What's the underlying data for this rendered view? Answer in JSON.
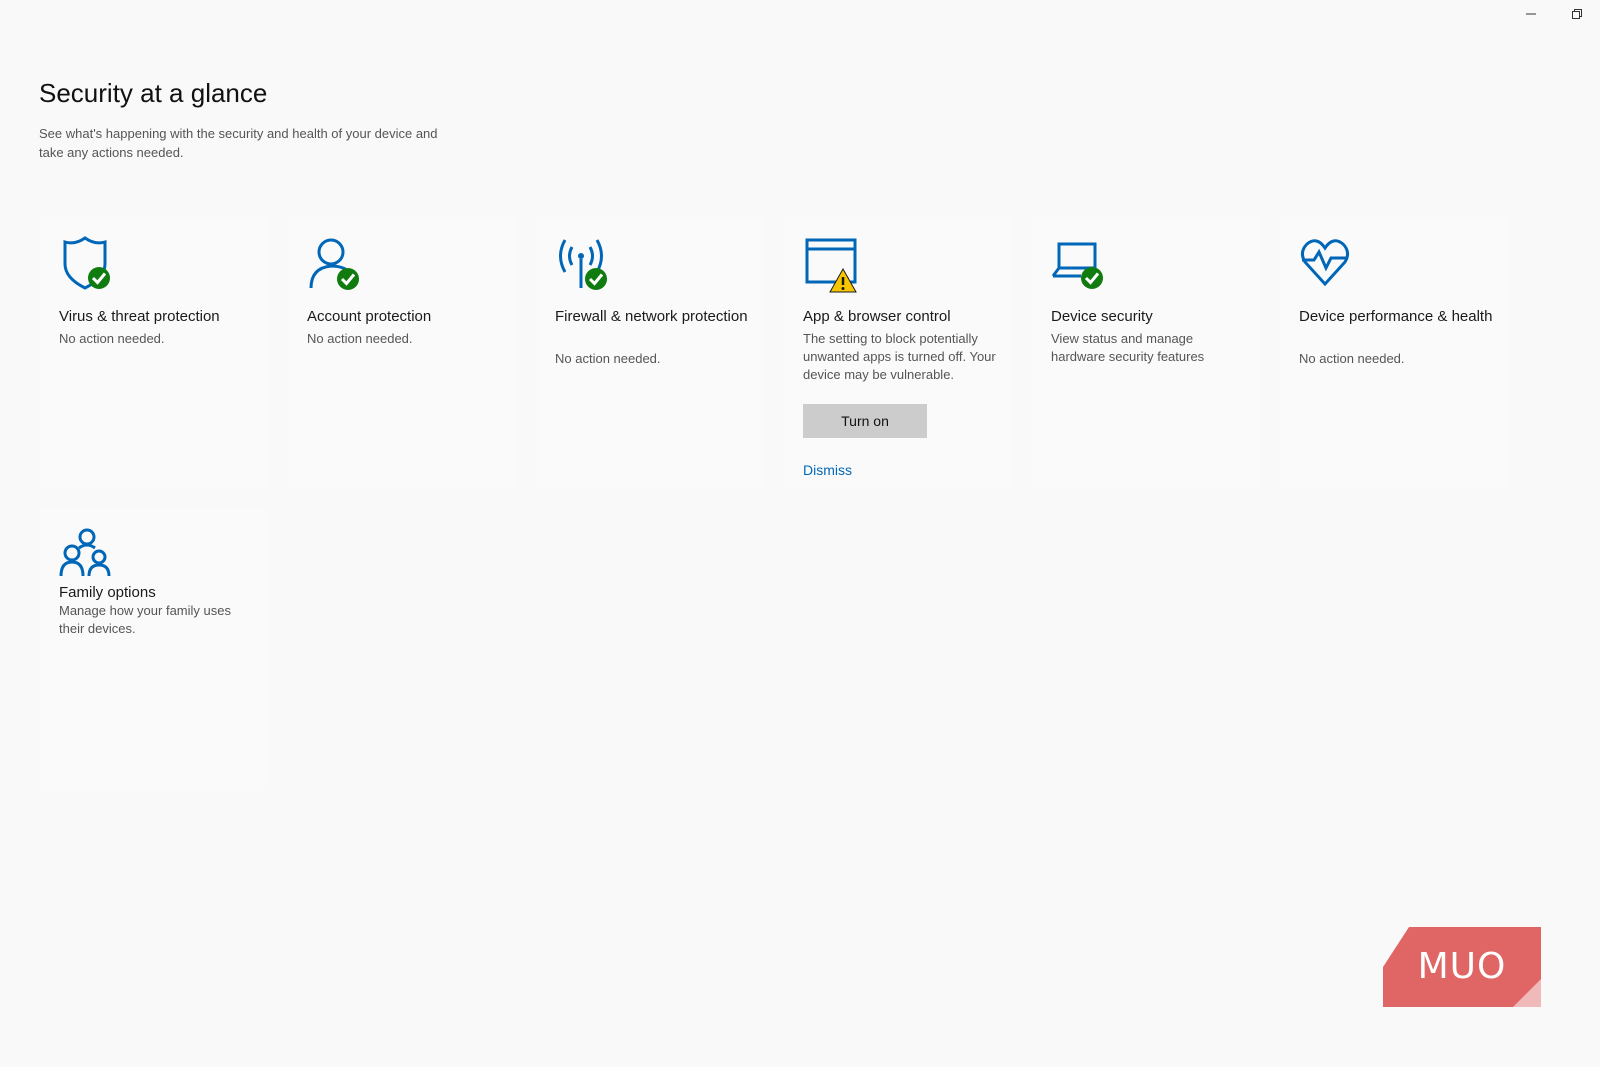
{
  "window": {
    "minimize_icon": "minimize-icon",
    "restore_icon": "restore-icon"
  },
  "header": {
    "title": "Security at a glance",
    "subtitle": "See what's happening with the security and health of your device and take any actions needed."
  },
  "tiles": [
    {
      "icon": "shield-check-icon",
      "title": "Virus & threat protection",
      "desc": "No action needed.",
      "status": "ok"
    },
    {
      "icon": "account-check-icon",
      "title": "Account protection",
      "desc": "No action needed.",
      "status": "ok"
    },
    {
      "icon": "network-check-icon",
      "title": "Firewall & network protection",
      "desc": "No action needed.",
      "status": "ok"
    },
    {
      "icon": "browser-warning-icon",
      "title": "App & browser control",
      "desc": "The setting to block potentially unwanted apps is turned off. Your device may be vulnerable.",
      "status": "warning",
      "button": "Turn on",
      "link": "Dismiss"
    },
    {
      "icon": "laptop-check-icon",
      "title": "Device security",
      "desc": "View status and manage hardware security features",
      "status": "info"
    },
    {
      "icon": "heart-pulse-icon",
      "title": "Device performance & health",
      "desc": "No action needed.",
      "status": "ok"
    },
    {
      "icon": "family-icon",
      "title": "Family options",
      "desc": "Manage how your family uses their devices.",
      "status": "info"
    }
  ],
  "colors": {
    "accent_blue": "#0067b8",
    "ok_green": "#107c10",
    "warning_yellow": "#f7c600",
    "logo_red": "#e06666"
  },
  "watermark": {
    "text": "MUO"
  }
}
